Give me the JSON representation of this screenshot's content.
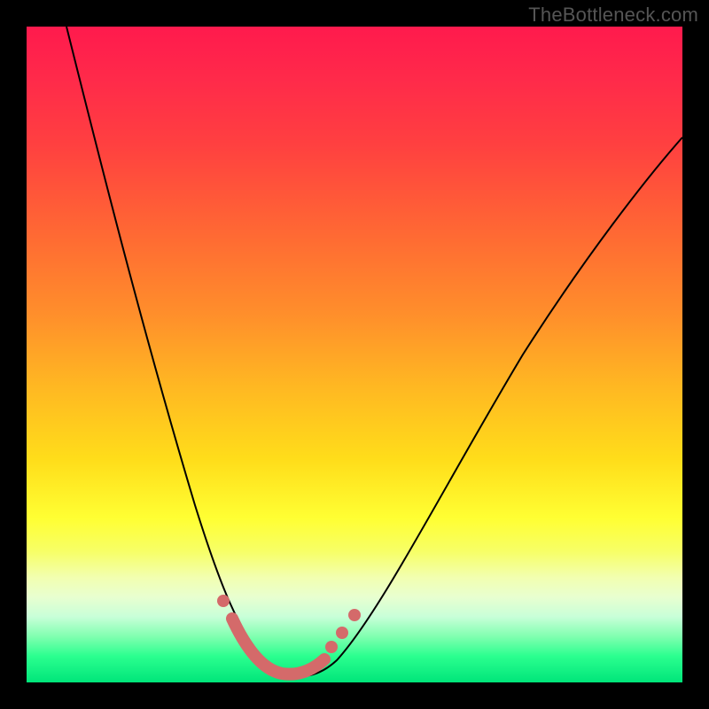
{
  "watermark": "TheBottleneck.com",
  "colors": {
    "background": "#000000",
    "curve": "#000000",
    "highlight": "#d46a6a"
  },
  "chart_data": {
    "type": "line",
    "title": "",
    "xlabel": "",
    "ylabel": "",
    "xlim": [
      0,
      100
    ],
    "ylim": [
      0,
      100
    ],
    "grid": false,
    "legend": false,
    "series": [
      {
        "name": "bottleneck-curve",
        "x": [
          6,
          10,
          14,
          18,
          22,
          26,
          30,
          33,
          35,
          37,
          39,
          41,
          44,
          48,
          54,
          62,
          72,
          84,
          100
        ],
        "y": [
          100,
          85,
          71,
          58,
          46,
          35,
          24,
          15,
          10,
          5,
          2,
          1,
          2,
          6,
          14,
          26,
          40,
          54,
          70
        ]
      }
    ],
    "highlight_region": {
      "name": "optimal-zone",
      "x": [
        32,
        34,
        36,
        38,
        40,
        42,
        44,
        46
      ],
      "y": [
        12,
        8,
        4,
        1,
        0.5,
        1,
        3,
        7
      ]
    },
    "background_gradient": {
      "top": "#ff1a4d",
      "mid": "#ffff33",
      "bottom": "#00e57a"
    }
  }
}
